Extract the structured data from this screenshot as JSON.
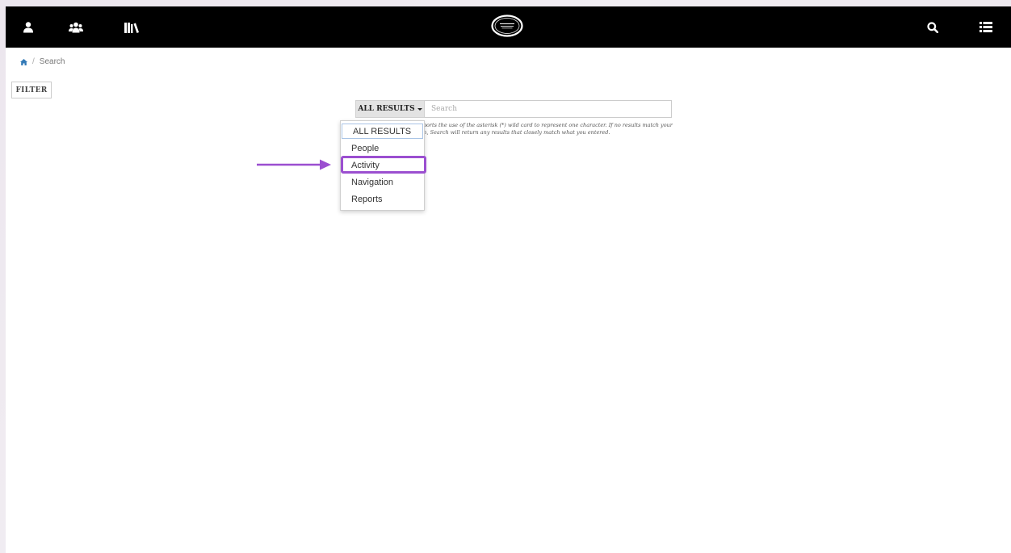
{
  "colors": {
    "navbar_bg": "#000000",
    "accent_highlight": "#9b4fd0",
    "link": "#337ab7"
  },
  "navbar": {
    "left_icons": [
      "user-icon",
      "users-group-icon",
      "library-icon"
    ],
    "logo_text": "Academy",
    "right_icons": [
      "search-icon",
      "list-menu-icon"
    ]
  },
  "breadcrumb": {
    "home_icon": "home-icon",
    "separator": "/",
    "current": "Search"
  },
  "filter": {
    "label": "FILTER"
  },
  "search": {
    "type_label": "ALL RESULTS",
    "placeholder": "Search",
    "help_text": "results may vary. Search supports the use of the asterisk (*) wild card to represent one character. If no results match your search, Search will return any results that closely match what you entered."
  },
  "dropdown": {
    "items": [
      {
        "label": "ALL RESULTS"
      },
      {
        "label": "People"
      },
      {
        "label": "Activity"
      },
      {
        "label": "Navigation"
      },
      {
        "label": "Reports"
      }
    ],
    "selected": "ALL RESULTS",
    "highlighted": "Activity"
  },
  "annotation": {
    "arrow_color": "#9b4fd0"
  }
}
